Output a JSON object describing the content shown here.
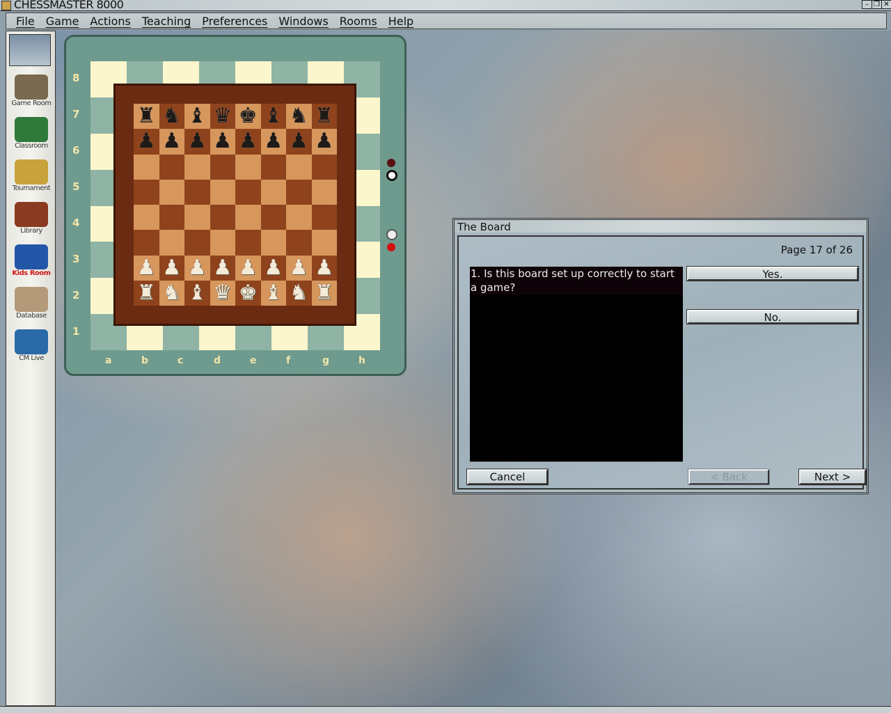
{
  "window": {
    "title": "CHESSMASTER 8000",
    "controls": [
      "minimize",
      "restore",
      "close"
    ]
  },
  "menu": [
    "File",
    "Game",
    "Actions",
    "Teaching",
    "Preferences",
    "Windows",
    "Rooms",
    "Help"
  ],
  "sidebar": [
    {
      "label": "Game Room",
      "color": "#7a6a50"
    },
    {
      "label": "Classroom",
      "color": "#2f7a3a"
    },
    {
      "label": "Tournament",
      "color": "#c8a23a"
    },
    {
      "label": "Library",
      "color": "#8a3a20"
    },
    {
      "label": "Kids Room",
      "color": "#2456a8",
      "label_color": "#cc1a1a"
    },
    {
      "label": "Database",
      "color": "#b59a7a"
    },
    {
      "label": "CM Live",
      "color": "#2a6aa8"
    }
  ],
  "board": {
    "ranks": [
      "8",
      "7",
      "6",
      "5",
      "4",
      "3",
      "2",
      "1"
    ],
    "files": [
      "a",
      "b",
      "c",
      "d",
      "e",
      "f",
      "g",
      "h"
    ],
    "position": [
      [
        "r",
        "n",
        "b",
        "q",
        "k",
        "b",
        "n",
        "r"
      ],
      [
        "p",
        "p",
        "p",
        "p",
        "p",
        "p",
        "p",
        "p"
      ],
      [
        "",
        "",
        "",
        "",
        "",
        "",
        "",
        ""
      ],
      [
        "",
        "",
        "",
        "",
        "",
        "",
        "",
        ""
      ],
      [
        "",
        "",
        "",
        "",
        "",
        "",
        "",
        ""
      ],
      [
        "",
        "",
        "",
        "",
        "",
        "",
        "",
        ""
      ],
      [
        "P",
        "P",
        "P",
        "P",
        "P",
        "P",
        "P",
        "P"
      ],
      [
        "R",
        "N",
        "B",
        "Q",
        "K",
        "B",
        "N",
        "R"
      ]
    ]
  },
  "dialog": {
    "title": "The Board",
    "page": "Page 17  of 26",
    "question": "1. Is this board set up correctly to start a game?",
    "yes": "Yes.",
    "no": "No.",
    "cancel": "Cancel",
    "back": "< Back",
    "next": "Next >"
  }
}
